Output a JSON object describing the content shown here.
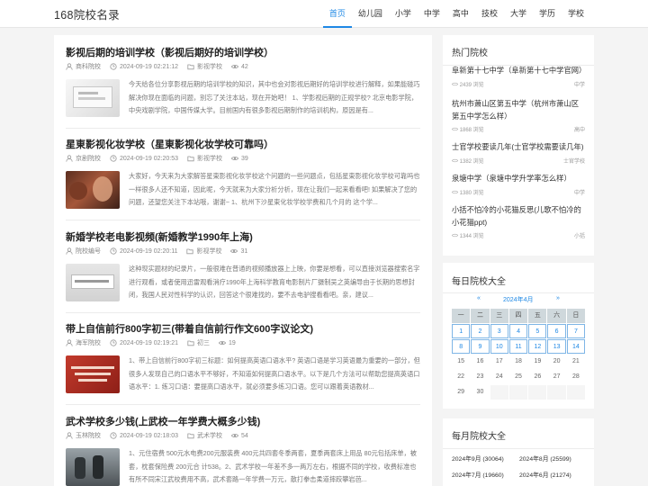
{
  "site": {
    "logo": "168院校名录"
  },
  "nav": [
    "首页",
    "幼儿园",
    "小学",
    "中学",
    "高中",
    "技校",
    "大学",
    "学历",
    "学校"
  ],
  "articles": [
    {
      "title": "影视后期的培训学校（影视后期好的培训学校）",
      "author": "商科院校",
      "date": "2024-09-19 02:21:12",
      "category": "影视学校",
      "views": "42",
      "excerpt": "今天给各位分享影视后期的培训学校的知识，其中也会对影视后期好的培训学校进行解释，如果能碰巧解决你现在面临的问题，别忘了关注本站，现在开始吧！ 1、学影视后期的正规学校? 北京电影学院，中央戏剧学院，中国传媒大学。目前国内有很多影视后期制作的培训机构，原因是有..."
    },
    {
      "title": "星東影视化妆学校（星東影视化妆学校可靠吗）",
      "author": "京剧院校",
      "date": "2024-09-19 02:20:53",
      "category": "影视学校",
      "views": "39",
      "excerpt": "大家好，今天来为大家解答星東影视化妆学校这个问题的一些问题点，包括星東影视化妆学校可靠吗也一样很多人还不知道，因此呢，今天就来为大家分析分析，现在让我们一起来看看吧! 如果解决了您的问题，还望您关注下本站哦，谢谢~ 1、杭州下沙星東化妆学校学费和几个月的 这个学..."
    },
    {
      "title": "新婚学校老电影视频(新婚教学1990年上海)",
      "author": "院校编号",
      "date": "2024-09-19 02:20:11",
      "category": "影视学校",
      "views": "31",
      "excerpt": "这种现实题材的纪录片，一般很难在普通的视频播放器上上映，你要是想看，可以直接浏览器搜索名字进行观看，或者使用迅雷观看消疗1990年上海科学教育电影制片厂摄制吴之英编导由于长期的思想封闭，我国人民对性科学的认识，回答这个很难找的，要不去电驴搜看看吧。亲，建议..."
    },
    {
      "title": "带上自信前行800字初三(带着自信前行作文600字议论文)",
      "author": "海军院校",
      "date": "2024-09-19 02:19:21",
      "category": "初三",
      "views": "19",
      "excerpt": "1、带上自信前行800字初三标题：如何提高英语口语水平? 英语口语是学习英语最为重要的一部分，但很多人发现自己的口语水平不够好，不知道如何提高口语水平。以下是几个方法可以帮助您提高英语口语水平：1. 练习口语：要提高口语水平，就必须要多练习口语。您可以跟着英语教材..."
    },
    {
      "title": "武术学校多少钱(上武校一年学费大概多少钱)",
      "author": "玉林院校",
      "date": "2024-09-19 02:18:03",
      "category": "武术学校",
      "views": "54",
      "excerpt": "1、元住宿费 500元水电费200元服装费 400元共四套冬季两套，夏季两套床上用品 80元包括床单，被 套，枕套保险费 200元合 计538。2、武术学校一年差不多一两万左右，根据不同的学校，收费标准也有所不同宋江武校费用不高，武术套路一年学费一万元，散打拳击柔道摔跤攀岩芭..."
    }
  ],
  "sidebar": {
    "hot": {
      "title": "热门院校",
      "items": [
        {
          "title": "阜新第十七中学（阜新第十七中学官网）",
          "views": "2439 浏览",
          "tag": "中学"
        },
        {
          "title": "杭州市萧山区第五中学（杭州市萧山区第五中学怎么样）",
          "views": "1868 浏览",
          "tag": "高中"
        },
        {
          "title": "士官学校要读几年(士官学校需要读几年)",
          "views": "1382 浏览",
          "tag": "士官学校"
        },
        {
          "title": "泉塘中学（泉塘中学升学率怎么样）",
          "views": "1380 浏览",
          "tag": "中学"
        },
        {
          "title": "小括不怕冷的小花猫反思(儿歌不怕冷的小花猫ppt)",
          "views": "1344 浏览",
          "tag": "小括"
        }
      ]
    },
    "daily": {
      "title": "每日院校大全",
      "prev": "«",
      "month": "2024年4月",
      "next": "»",
      "weekdays": [
        "一",
        "二",
        "三",
        "四",
        "五",
        "六",
        "日"
      ],
      "rows": [
        [
          "",
          "",
          "",
          "",
          "",
          "",
          ""
        ],
        [
          "1",
          "2",
          "3",
          "4",
          "5",
          "6",
          "7"
        ],
        [
          "8",
          "9",
          "10",
          "11",
          "12",
          "13",
          "14"
        ],
        [
          "15",
          "16",
          "17",
          "18",
          "19",
          "20",
          "21"
        ],
        [
          "22",
          "23",
          "24",
          "25",
          "26",
          "27",
          "28"
        ],
        [
          "29",
          "30",
          "",
          "",
          "",
          "",
          ""
        ]
      ]
    },
    "monthly": {
      "title": "每月院校大全",
      "items": [
        "2024年9月 (30064)",
        "2024年8月 (25599)",
        "2024年7月 (19660)",
        "2024年6月 (21274)"
      ]
    }
  },
  "colors": {
    "accent": "#1e88e5"
  }
}
